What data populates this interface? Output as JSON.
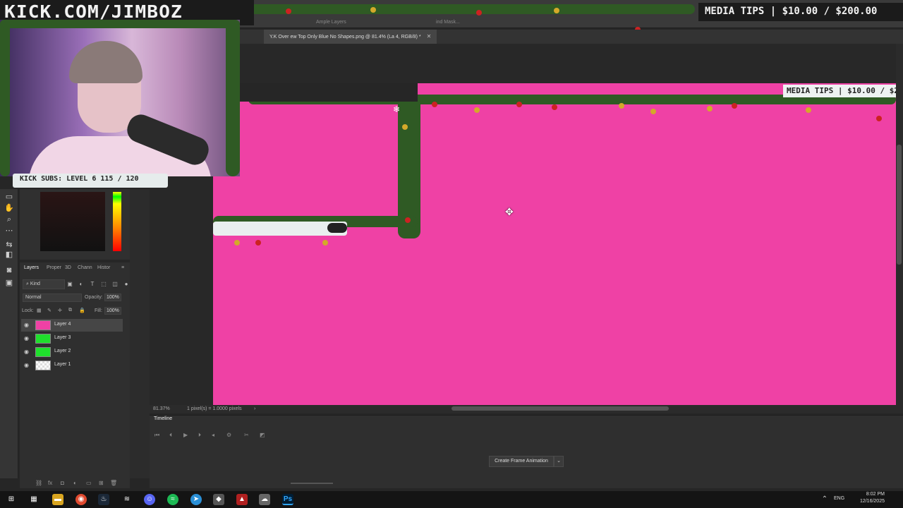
{
  "overlay": {
    "brand": "KICK.COM/JIMBOZ",
    "subs_label": "KICK SUBS: LEVEL 6 115 / 120",
    "tips_label": "MEDIA TIPS | $10.00 / $200.00",
    "tips_label_inner": "MEDIA TIPS | $10.00 / $2"
  },
  "app": {
    "doc_tabs": [
      "Ample Layers",
      "ind Mask..."
    ],
    "active_doc_tab": "Y.K Over  ew Top Only Blue No Shapes.png @ 81.4% (La   4, RGB/8) *",
    "colors": {
      "document_fill": "#ef41a5",
      "panel_bg": "#2f2f2f",
      "canvas_bg": "#282828"
    }
  },
  "tools": [
    "move-tool",
    "hand-tool",
    "zoom-tool",
    "more-tools",
    "swap-colors",
    "default-colors",
    "quick-mask",
    "screen-mode"
  ],
  "panels": {
    "tabs": [
      "Layers",
      "Proper",
      "3D",
      "Chann",
      "Histor"
    ],
    "active_tab": "Layers",
    "kind_filter": "Kind",
    "blend_mode": "Normal",
    "opacity_label": "Opacity:",
    "opacity_value": "100%",
    "lock_label": "Lock:",
    "fill_label": "Fill:",
    "fill_value": "100%",
    "layers": [
      {
        "name": "Layer 4",
        "thumb": "#ef41a5",
        "selected": true
      },
      {
        "name": "Layer 3",
        "thumb": "#1fe02c",
        "selected": false
      },
      {
        "name": "Layer 2",
        "thumb": "#1fe02c",
        "selected": false
      },
      {
        "name": "Layer 1",
        "thumb": "checker",
        "selected": false
      }
    ]
  },
  "status": {
    "zoom": "81.37%",
    "doc_info": "1 pixel(s) = 1.0000 pixels"
  },
  "timeline": {
    "title": "Timeline",
    "create_button": "Create Frame Animation",
    "dropdown_arrow": "⌄"
  },
  "taskbar": {
    "lang": "ENG",
    "time": "8:02 PM",
    "date": "12/16/2025"
  }
}
